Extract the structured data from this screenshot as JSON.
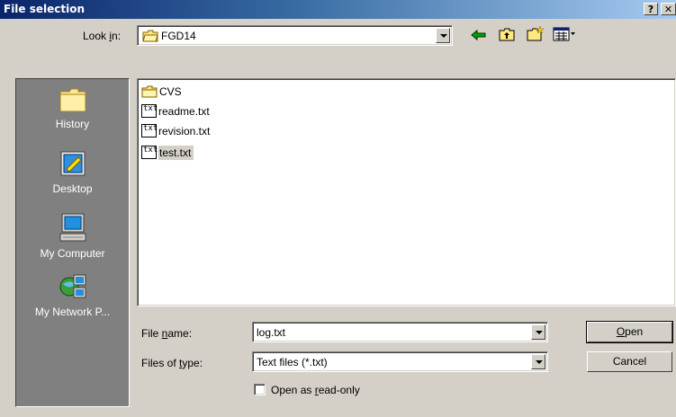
{
  "window": {
    "title": "File selection",
    "help_button": "?",
    "close_button": "✕"
  },
  "lookin": {
    "label_pre": "Look ",
    "label_accel": "i",
    "label_post": "n:",
    "value": "FGD14"
  },
  "toolbar": {
    "back_icon": "back-arrow-icon",
    "up_icon": "up-folder-icon",
    "new_folder_icon": "new-folder-icon",
    "view_menu_icon": "view-menu-icon"
  },
  "places": [
    {
      "label": "History",
      "icon": "history-icon"
    },
    {
      "label": "Desktop",
      "icon": "desktop-icon"
    },
    {
      "label": "My Computer",
      "icon": "computer-icon"
    },
    {
      "label": "My Network P...",
      "icon": "network-icon"
    }
  ],
  "files": [
    {
      "name": "CVS",
      "type": "folder",
      "selected": false
    },
    {
      "name": "readme.txt",
      "type": "txt",
      "selected": false
    },
    {
      "name": "revision.txt",
      "type": "txt",
      "selected": false
    },
    {
      "name": "test.txt",
      "type": "txt",
      "selected": true
    }
  ],
  "txt_icon_text": "txt",
  "filename": {
    "label_pre": "File ",
    "label_accel": "n",
    "label_post": "ame:",
    "value": "log.txt"
  },
  "filetype": {
    "label_pre": "Files of ",
    "label_accel": "t",
    "label_post": "ype:",
    "value": "Text files (*.txt)"
  },
  "readonly": {
    "label_pre": "Open as ",
    "label_accel": "r",
    "label_post": "ead-only",
    "checked": false
  },
  "buttons": {
    "open_accel": "O",
    "open_rest": "pen",
    "cancel": "Cancel"
  }
}
